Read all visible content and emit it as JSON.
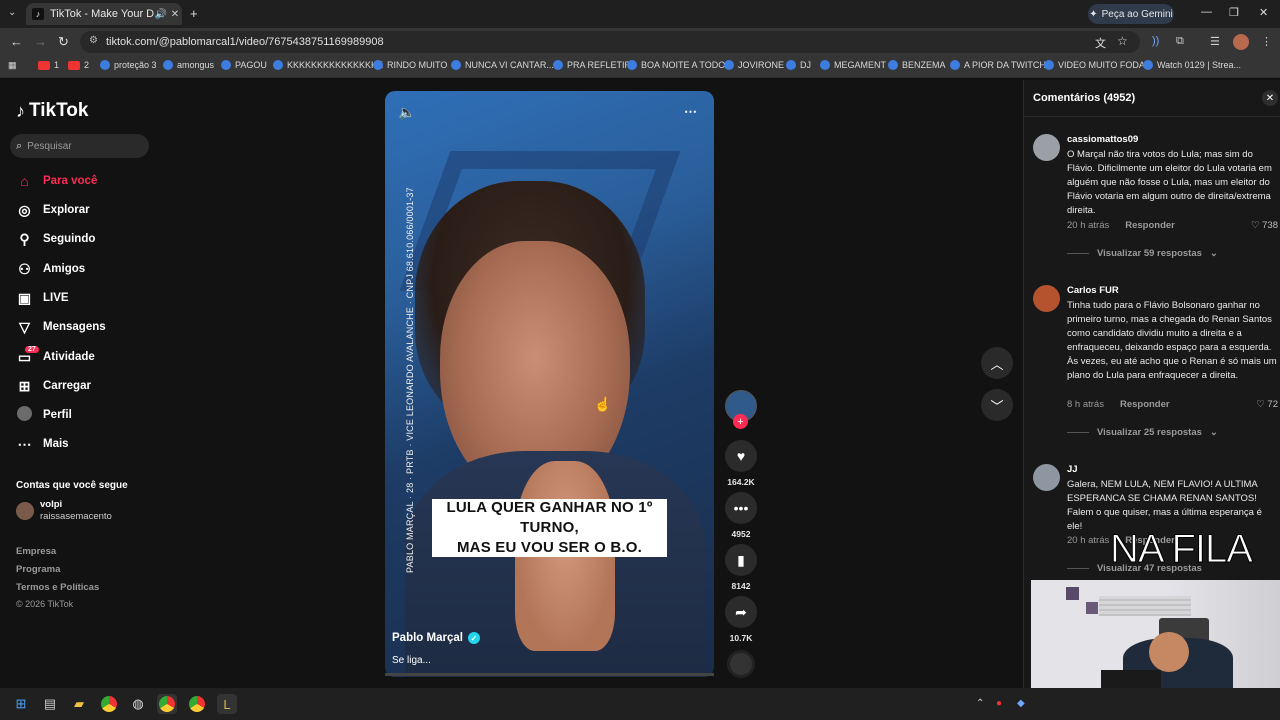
{
  "browser": {
    "tab_title": "TikTok - Make Your Day",
    "gemini_label": "Peça ao Gemini",
    "url": "tiktok.com/@pablomarcal1/video/7675438751169989908",
    "bookmarks": [
      "1",
      "2",
      "proteção 3",
      "amongus",
      "PAGOU",
      "KKKKKKKKKKKKKKKK",
      "RINDO MUITO",
      "NUNCA VI CANTAR...",
      "PRA REFLETIR",
      "BOA NOITE A TODO",
      "JOVIRONE",
      "DJ",
      "MEGAMENT",
      "BENZEMA",
      "A PIOR DA TWITCH",
      "VIDEO MUITO FODA",
      "Watch 0129 | Strea..."
    ]
  },
  "sidebar": {
    "logo": "TikTok",
    "search_placeholder": "Pesquisar",
    "items": [
      {
        "label": "Para você",
        "icon": "home-icon"
      },
      {
        "label": "Explorar",
        "icon": "compass-icon"
      },
      {
        "label": "Seguindo",
        "icon": "user-follow-icon"
      },
      {
        "label": "Amigos",
        "icon": "friends-icon"
      },
      {
        "label": "LIVE",
        "icon": "live-icon"
      },
      {
        "label": "Mensagens",
        "icon": "messages-icon"
      },
      {
        "label": "Atividade",
        "icon": "activity-icon",
        "badge": "27"
      },
      {
        "label": "Carregar",
        "icon": "upload-icon"
      },
      {
        "label": "Perfil",
        "icon": "profile-icon"
      },
      {
        "label": "Mais",
        "icon": "more-icon"
      }
    ],
    "following_heading": "Contas que você segue",
    "following": {
      "name": "volpi",
      "handle": "raissasemacento"
    },
    "footer": [
      "Empresa",
      "Programa",
      "Termos e Políticas",
      "© 2026 TikTok"
    ]
  },
  "video": {
    "vertical_text": "PABLO MARÇAL · 28 · PRTB · VICE LEONARDO AVALANCHE · CNPJ 68.610.066/0001-37",
    "caption_line1": "LULA QUER GANHAR NO 1º TURNO,",
    "caption_line2": "MAS EU VOU SER O B.O.",
    "author": "Pablo Marçal",
    "description": "Se liga...",
    "likes": "164.2K",
    "comments": "4952",
    "saves": "8142",
    "shares": "10.7K"
  },
  "comments_panel": {
    "title": "Comentários",
    "count": "(4952)",
    "comments": [
      {
        "user": "cassiomattos09",
        "text": "O Marçal não tira votos do Lula; mas sim do Flávio. Dificilmente um eleitor do Lula votaria em alguém que não fosse o Lula, mas um eleitor do Flávio votaria em algum outro de direita/extrema direita.",
        "time": "20 h atrás",
        "reply": "Responder",
        "likes": "738",
        "replies": "Visualizar 59 respostas"
      },
      {
        "user": "Carlos FUR",
        "text": "Tinha tudo para o Flávio Bolsonaro ganhar no primeiro turno, mas a chegada do Renan Santos como candidato dividiu muito a direita e a enfraqueceu, deixando espaço para a esquerda. Às vezes, eu até acho que o Renan é só mais um plano do Lula para enfraquecer a direita.",
        "time": "8 h atrás",
        "reply": "Responder",
        "likes": "72",
        "replies": "Visualizar 25 respostas"
      },
      {
        "user": "JJ",
        "text": "Galera, NEM LULA, NEM FLAVIO! A ULTIMA ESPERANCA SE CHAMA RENAN SANTOS! Falem o que quiser, mas a última esperança é ele!",
        "time": "20 h atrás",
        "reply": "Responder",
        "likes": "",
        "replies": "Visualizar 47 respostas"
      }
    ]
  },
  "overlay": {
    "nafila": "NA FILA"
  },
  "colors": {
    "accent": "#fe2c55",
    "verified": "#20d5ec"
  }
}
